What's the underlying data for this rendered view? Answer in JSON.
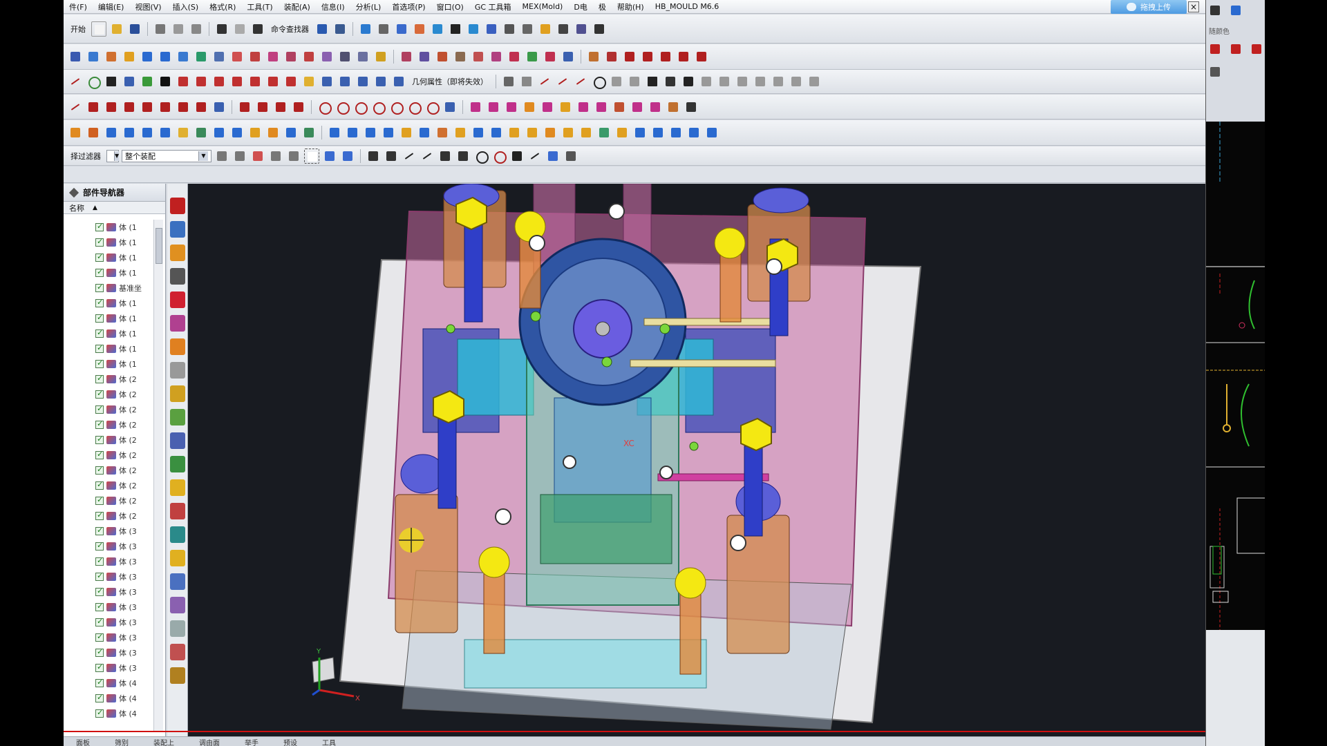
{
  "menubar": {
    "items": [
      "件(F)",
      "编辑(E)",
      "视图(V)",
      "插入(S)",
      "格式(R)",
      "工具(T)",
      "装配(A)",
      "信息(I)",
      "分析(L)",
      "首选项(P)",
      "窗口(O)",
      "GC 工具箱",
      "MEX(Mold)",
      "D电",
      "极",
      "帮助(H)",
      "HB_MOULD M6.6"
    ],
    "upload_label": "拖拽上传",
    "close": "×"
  },
  "toolbar1": {
    "start_label": "开始",
    "command_finder": "命令查找器"
  },
  "toolbar3": {
    "geometry_label": "几何属性（即将失效）"
  },
  "toolbar6": {
    "filter_label": "择过滤器",
    "scope_label": "整个装配"
  },
  "navigator": {
    "title": "部件导航器",
    "column": "名称",
    "rows": [
      {
        "label": "体 (1"
      },
      {
        "label": "体 (1"
      },
      {
        "label": "体 (1"
      },
      {
        "label": "体 (1"
      },
      {
        "label": "基准坐"
      },
      {
        "label": "体 (1"
      },
      {
        "label": "体 (1"
      },
      {
        "label": "体 (1"
      },
      {
        "label": "体 (1"
      },
      {
        "label": "体 (1"
      },
      {
        "label": "体 (2"
      },
      {
        "label": "体 (2"
      },
      {
        "label": "体 (2"
      },
      {
        "label": "体 (2"
      },
      {
        "label": "体 (2"
      },
      {
        "label": "体 (2"
      },
      {
        "label": "体 (2"
      },
      {
        "label": "体 (2"
      },
      {
        "label": "体 (2"
      },
      {
        "label": "体 (2"
      },
      {
        "label": "体 (3"
      },
      {
        "label": "体 (3"
      },
      {
        "label": "体 (3"
      },
      {
        "label": "体 (3"
      },
      {
        "label": "体 (3"
      },
      {
        "label": "体 (3"
      },
      {
        "label": "体 (3"
      },
      {
        "label": "体 (3"
      },
      {
        "label": "体 (3"
      },
      {
        "label": "体 (3"
      },
      {
        "label": "体 (4"
      },
      {
        "label": "体 (4"
      },
      {
        "label": "体 (4"
      }
    ]
  },
  "viewport": {
    "axis_x": "X",
    "axis_y": "Y",
    "wcs_label": "XC"
  },
  "bottom_tabs": [
    "面板",
    "筛别",
    "装配上",
    "调由面",
    "举手",
    "预设",
    "工具"
  ],
  "right_panel": {
    "label": "随颜色"
  }
}
